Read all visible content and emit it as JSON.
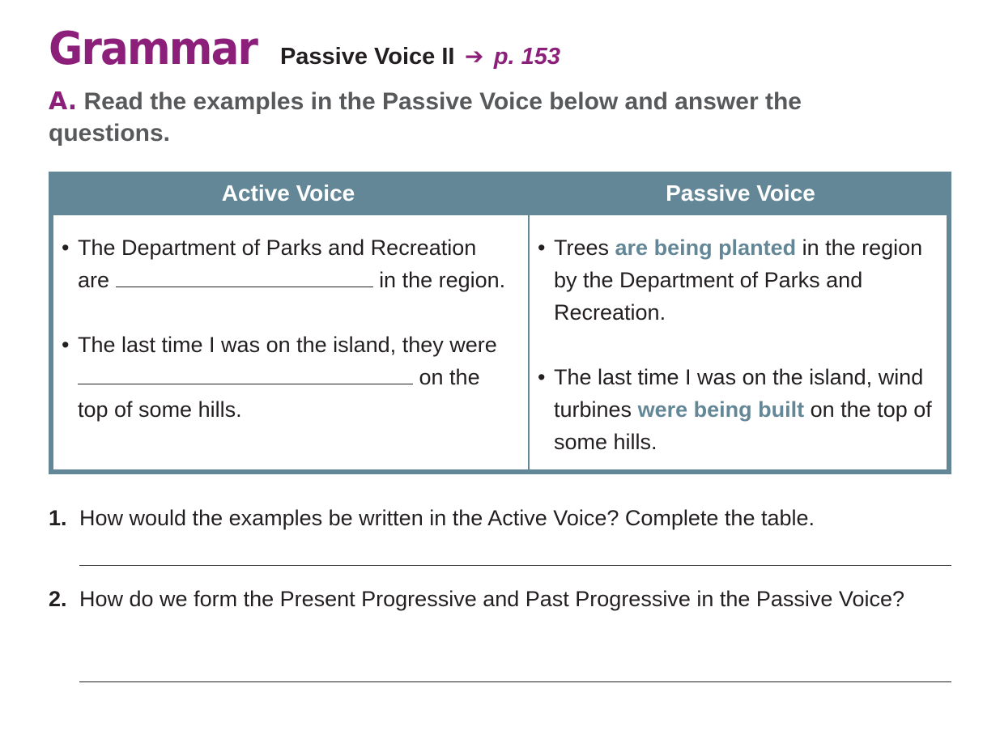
{
  "header": {
    "brand": "Grammar",
    "topic": "Passive Voice II",
    "arrow": "➔",
    "page_ref": "p. 153"
  },
  "instruction": {
    "letter": "A.",
    "text": "Read the examples in the Passive Voice below and answer the questions."
  },
  "table": {
    "headers": [
      "Active Voice",
      "Passive Voice"
    ],
    "active": [
      {
        "before": "The Department of Parks and Recreation are",
        "after": "in the region."
      },
      {
        "before": "The last time I was on the island, they were",
        "after": "on the top of some hills."
      }
    ],
    "passive": [
      {
        "before": "Trees",
        "highlight": "are being planted",
        "after": "in the region by the Department of Parks and Recreation."
      },
      {
        "before": "The last time I was on the island, wind turbines",
        "highlight": "were being built",
        "after": "on the top of some hills."
      }
    ]
  },
  "questions": [
    {
      "number": "1.",
      "text": "How would the examples be written in the Active Voice? Complete the table."
    },
    {
      "number": "2.",
      "text": "How do we form the Present Progressive and Past Progressive in the Passive Voice?"
    }
  ],
  "colors": {
    "brand": "#8c1f7a",
    "table_header": "#638796",
    "highlight_text": "#638796",
    "instruction_text": "#58595b"
  }
}
